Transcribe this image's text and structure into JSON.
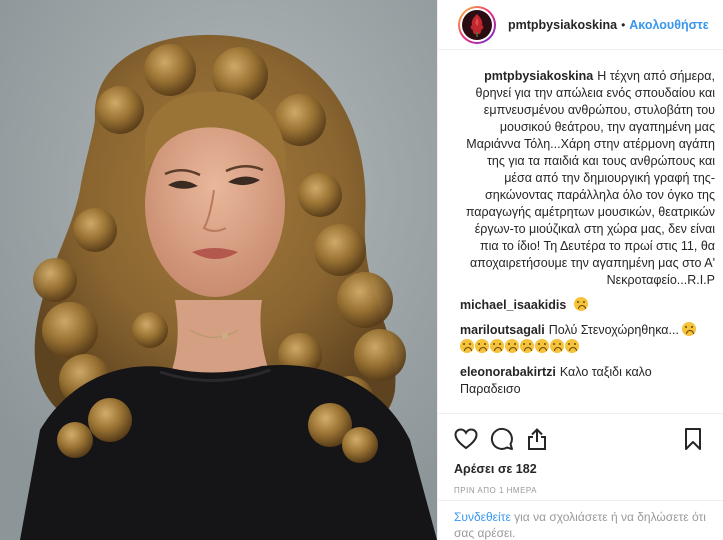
{
  "post": {
    "username": "pmtpbysiakoskina",
    "dot": "•",
    "follow_label": "Ακολουθήστε",
    "avatar_icon": "red-flower-avatar-icon"
  },
  "caption": {
    "username": "pmtpbysiakoskina",
    "text": "Η τέχνη από σήμερα, θρηνεί για την απώλεια ενός σπουδαίου και εμπνευσμένου ανθρώπου, στυλοβάτη του μουσικού θεάτρου, την αγαπημένη μας Μαριάννα Τόλη...Χάρη στην ατέρμονη αγάπη της για τα παιδιά και τους ανθρώπους και μέσα από την δημιουργική γραφή της-σηκώνοντας παράλληλα όλο τον όγκο της παραγωγής αμέτρητων μουσικών, θεατρικών έργων-το μιούζικαλ στη χώρα μας, δεν είναι πια το ίδιο! Τη Δευτέρα το πρωί στις 11, θα αποχαιρετήσουμε την αγαπημένη μας στο Α' Νεκροταφείο...R.I.P"
  },
  "comments": [
    {
      "username": "michael_isaakidis",
      "text": "",
      "emoji_count": 1,
      "emoji": "sad-face-emoji"
    },
    {
      "username": "mariloutsagali",
      "text": "Πολύ Στενοχώρηθηκα...",
      "emoji_count": 9,
      "emoji": "sad-face-emoji"
    },
    {
      "username": "eleonorabakirtzi",
      "text": "Καλο ταξιδι καλο Παραδεισο",
      "emoji_count": 0,
      "emoji": ""
    }
  ],
  "actions": {
    "like_icon": "heart-icon",
    "comment_icon": "comment-icon",
    "share_icon": "share-icon",
    "bookmark_icon": "bookmark-icon"
  },
  "likes_text": "Αρέσει σε 182",
  "timestamp": "ΠΡΙΝ ΑΠΟ 1 ΗΜΕΡΑ",
  "login_prompt": {
    "link_text": "Συνδεθείτε",
    "rest_text": "για να σχολιάσετε ή να δηλώσετε ότι σας αρέσει."
  },
  "colors": {
    "link_blue": "#3897f0",
    "text": "#262626",
    "muted": "#999999",
    "border": "#efefef"
  }
}
